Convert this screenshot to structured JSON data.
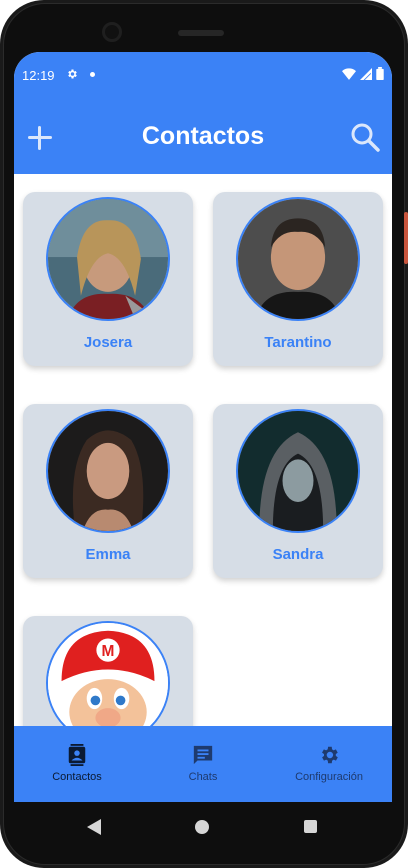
{
  "status_bar": {
    "time": "12:19"
  },
  "app_bar": {
    "title": "Contactos"
  },
  "contacts": [
    {
      "name": "Josera"
    },
    {
      "name": "Tarantino"
    },
    {
      "name": "Emma"
    },
    {
      "name": "Sandra"
    },
    {
      "name": ""
    }
  ],
  "bottom_nav": {
    "items": [
      {
        "label": "Contactos",
        "icon": "contact-card-icon",
        "selected": true
      },
      {
        "label": "Chats",
        "icon": "chat-bubble-icon",
        "selected": false
      },
      {
        "label": "Configuración",
        "icon": "gear-icon",
        "selected": false
      }
    ]
  },
  "colors": {
    "primary": "#3b82f6",
    "card_background": "#d6dde6",
    "selected_nav_text": "#0b1a33",
    "unselected_nav_text": "#1e3a6e"
  }
}
